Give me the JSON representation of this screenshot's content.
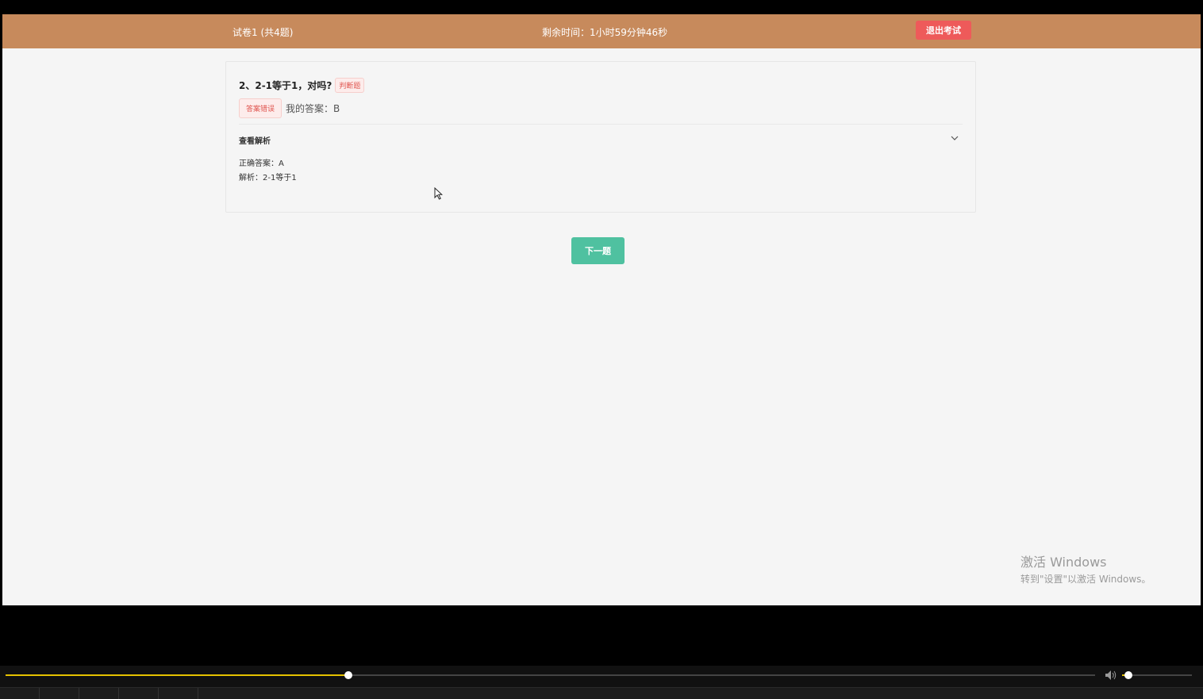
{
  "header": {
    "paper_title": "试卷1 (共4题)",
    "timer": "剩余时间：1小时59分钟46秒",
    "exit_label": "退出考试",
    "bg_color": "#c78a5c"
  },
  "question": {
    "text": "2、2-1等于1，对吗?",
    "type_tag": "判断题",
    "status_tag": "答案错误",
    "my_answer": "我的答案：B"
  },
  "analysis": {
    "title": "查看解析",
    "correct_answer": "正确答案：A",
    "explanation": "解析：2-1等于1"
  },
  "next_label": "下一题",
  "watermark": {
    "title": "激活 Windows",
    "subtitle": "转到\"设置\"以激活 Windows。"
  },
  "player": {
    "progress": 0.315,
    "volume": 0.09
  },
  "icons": {
    "chevron": "chevron-down-icon",
    "volume": "volume-icon",
    "cursor": "mouse-cursor-icon"
  }
}
